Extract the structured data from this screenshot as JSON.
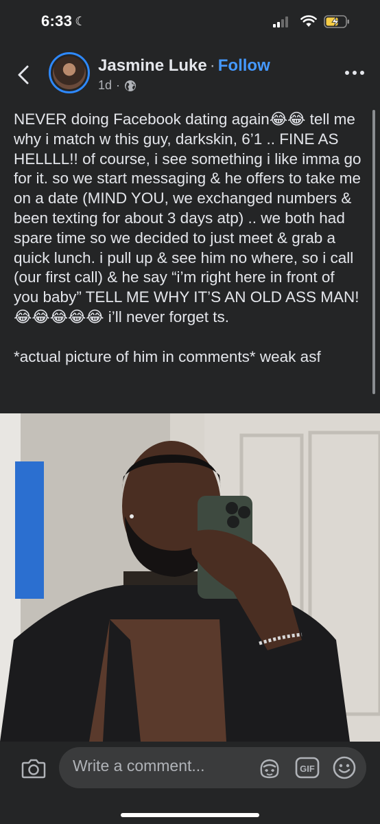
{
  "status_bar": {
    "time": "6:33",
    "dnd_icon": "moon-icon"
  },
  "header": {
    "author_name": "Jasmine Luke",
    "separator": "·",
    "follow_label": "Follow",
    "post_age": "1d",
    "meta_separator": "·",
    "privacy_icon": "globe-icon"
  },
  "post": {
    "paragraphs": [
      "NEVER doing Facebook dating again😂😂 tell me why i match w this guy, darkskin, 6’1 .. FINE AS HELLLL!! of course, i see something i like imma go for it. so we start messaging & he offers to take me on a date (MIND YOU, we exchanged numbers & been texting for about 3 days atp) .. we both had spare time so we decided to just meet & grab a quick lunch. i pull up & see him no where, so i call (our first call) & he say “i’m right here in front of you baby” TELL ME WHY IT’S AN OLD ASS MAN! 😂😂😂😂😂 i’ll never forget ts.",
      "*actual picture of him in comments* weak asf"
    ]
  },
  "comment_bar": {
    "placeholder": "Write a comment...",
    "gif_label": "GIF"
  },
  "colors": {
    "background": "#242526",
    "text": "#e4e6eb",
    "secondary_text": "#b0b3b8",
    "accent": "#4599ff",
    "input_bg": "#3a3b3c"
  }
}
